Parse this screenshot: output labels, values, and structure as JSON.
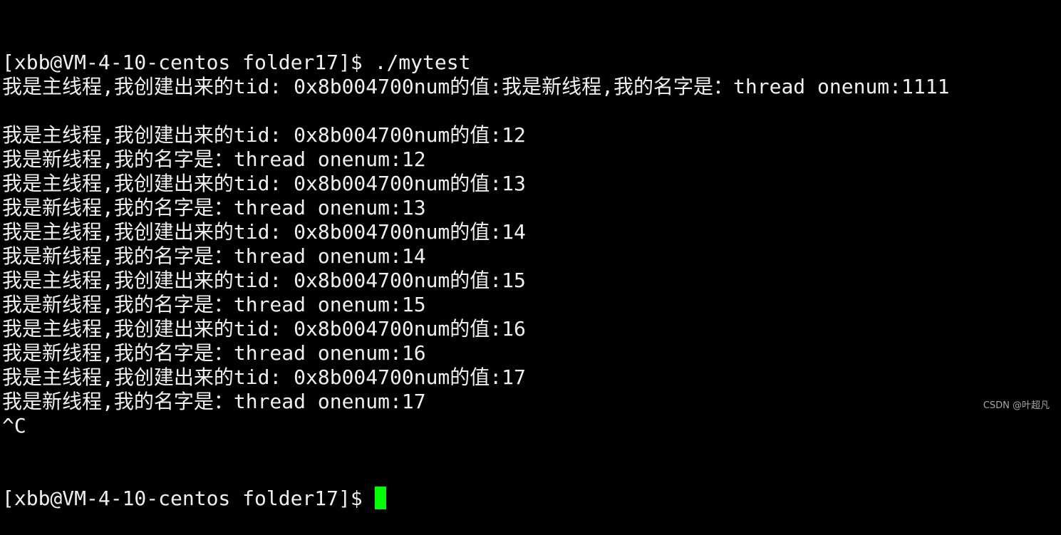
{
  "terminal": {
    "lines": [
      "[xbb@VM-4-10-centos folder17]$ ./mytest",
      "我是主线程,我创建出来的tid: 0x8b004700num的值:我是新线程,我的名字是：thread onenum:1111",
      "",
      "我是主线程,我创建出来的tid: 0x8b004700num的值:12",
      "我是新线程,我的名字是：thread onenum:12",
      "我是主线程,我创建出来的tid: 0x8b004700num的值:13",
      "我是新线程,我的名字是：thread onenum:13",
      "我是主线程,我创建出来的tid: 0x8b004700num的值:14",
      "我是新线程,我的名字是：thread onenum:14",
      "我是主线程,我创建出来的tid: 0x8b004700num的值:15",
      "我是新线程,我的名字是：thread onenum:15",
      "我是主线程,我创建出来的tid: 0x8b004700num的值:16",
      "我是新线程,我的名字是：thread onenum:16",
      "我是主线程,我创建出来的tid: 0x8b004700num的值:17",
      "我是新线程,我的名字是：thread onenum:17",
      "^C"
    ],
    "prompt": "[xbb@VM-4-10-centos folder17]$",
    "cursor_color": "#00ff00",
    "background": "#000000"
  },
  "watermark": "CSDN @叶超凡"
}
